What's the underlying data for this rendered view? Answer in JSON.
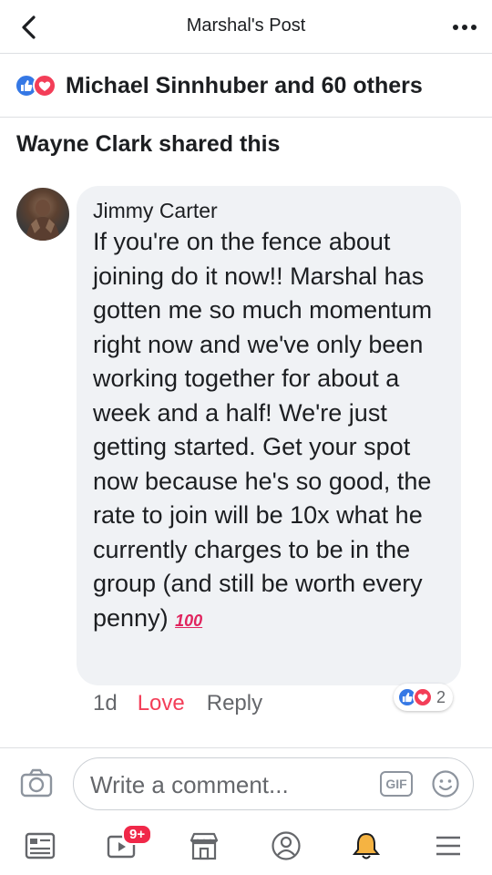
{
  "header": {
    "title": "Marshal's Post"
  },
  "reactions": {
    "summary": "Michael Sinnhuber and 60 others"
  },
  "share": {
    "text": "Wayne Clark shared this"
  },
  "comment": {
    "author": "Jimmy Carter",
    "text": "If you're on the fence about joining do it now!! Marshal has gotten me so much momentum right now and we've only been working together for about a week and a half! We're just getting started. Get your spot now because he's so good, the rate to join will be 10x what he currently charges to be in the group (and still be worth every penny)",
    "emoji": "100",
    "time": "1d",
    "love_label": "Love",
    "reply_label": "Reply",
    "reaction_count": "2"
  },
  "composer": {
    "placeholder": "Write a comment...",
    "gif_label": "GIF"
  },
  "tabbar": {
    "notification_badge": "9+"
  },
  "colors": {
    "like_blue": "#3578e5",
    "love_red": "#f33e58",
    "badge_red": "#f02849",
    "bubble_gray": "#f0f2f5"
  },
  "icons": [
    "back-icon",
    "more-icon",
    "like-reaction-icon",
    "love-reaction-icon",
    "camera-icon",
    "gif-icon",
    "emoji-icon",
    "news-feed-icon",
    "watch-icon",
    "marketplace-icon",
    "profile-icon",
    "notifications-icon",
    "menu-icon"
  ]
}
